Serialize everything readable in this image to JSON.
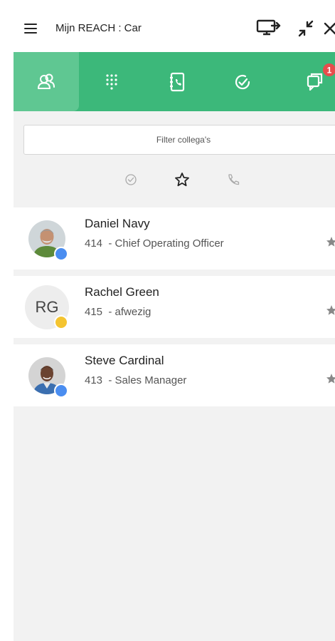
{
  "header": {
    "title": "Mijn REACH : Car"
  },
  "nav": {
    "badge_count": "1"
  },
  "filter": {
    "placeholder": "Filter collega's"
  },
  "contacts": [
    {
      "name": "Daniel Navy",
      "extension": "414",
      "detail": "Chief Operating Officer",
      "status_color": "#4a8df0",
      "initials": ""
    },
    {
      "name": "Rachel Green",
      "extension": "415",
      "detail": "afwezig",
      "status_color": "#f4c430",
      "initials": "RG"
    },
    {
      "name": "Steve Cardinal",
      "extension": "413",
      "detail": "Sales Manager",
      "status_color": "#4a8df0",
      "initials": ""
    }
  ],
  "colors": {
    "nav_green": "#3cb87a",
    "nav_active": "#5fc792",
    "badge_red": "#e74c4c"
  },
  "icons": [
    "menu-icon",
    "screen-share-icon",
    "collapse-icon",
    "close-icon",
    "colleagues-icon",
    "dialpad-icon",
    "contacts-book-icon",
    "check-circle-icon",
    "chat-icon",
    "star-icon",
    "phone-icon"
  ]
}
